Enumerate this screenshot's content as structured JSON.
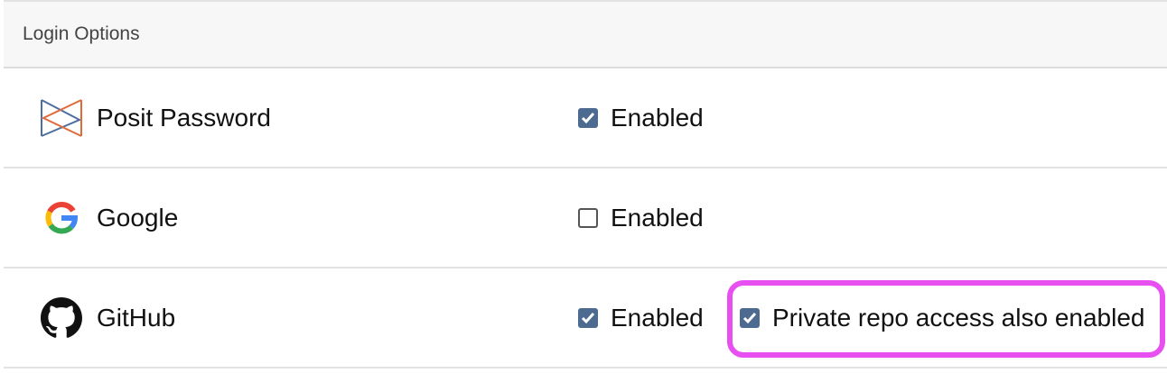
{
  "header": {
    "title": "Login Options"
  },
  "rows": [
    {
      "name": "Posit Password",
      "icon": "posit-logo-icon",
      "enabled_label": "Enabled",
      "enabled": true
    },
    {
      "name": "Google",
      "icon": "google-logo-icon",
      "enabled_label": "Enabled",
      "enabled": false
    },
    {
      "name": "GitHub",
      "icon": "github-logo-icon",
      "enabled_label": "Enabled",
      "enabled": true,
      "extra_label": "Private repo access also enabled",
      "extra_enabled": true
    }
  ],
  "colors": {
    "checkbox": "#4d6b91",
    "highlight": "#e84ff0"
  }
}
